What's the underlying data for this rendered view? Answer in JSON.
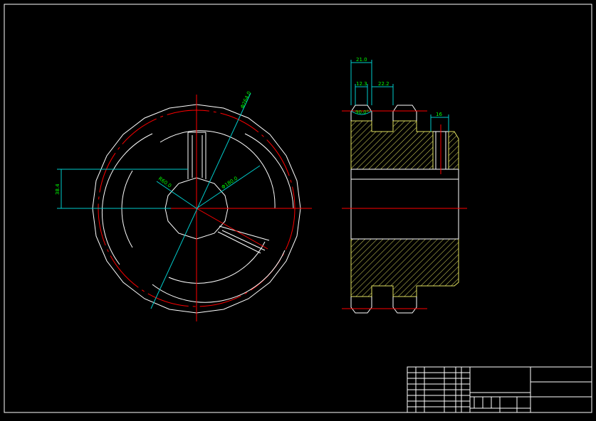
{
  "colors": {
    "background": "#000000",
    "outline": "#ffffff",
    "centerline": "#ff0000",
    "dimension_line": "#00cccc",
    "dimension_text": "#00ff00",
    "hatch": "#e0e060"
  },
  "front_view": {
    "dims": {
      "outer_diameter": "Φ264.0",
      "pitch_diameter": "Φ180.0",
      "hub_diameter": "R60.0",
      "keyway_height": "38.4"
    }
  },
  "side_view": {
    "dims": {
      "tooth_width": "21.0",
      "tooth_gap": "12.3",
      "tooth_pitch": "22.2",
      "root_angle": "90.0°",
      "rim_width": "16"
    }
  },
  "title_block": {
    "present": true
  }
}
